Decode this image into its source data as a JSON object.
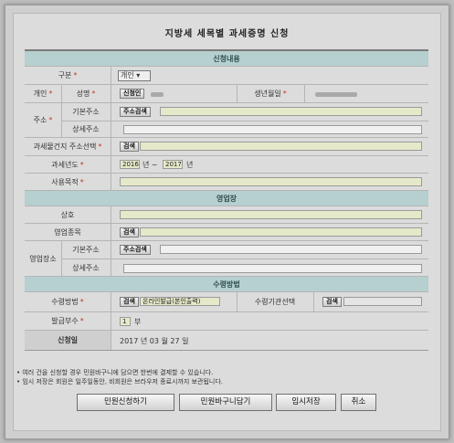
{
  "title": "지방세 세목별 과세증명 신청",
  "sections": {
    "apply": "신청내용",
    "business": "영업장",
    "receive": "수령방법"
  },
  "labels": {
    "category": "구분",
    "personal": "개인",
    "name": "성명",
    "birth": "생년월일",
    "address": "주소",
    "basic_address": "기본주소",
    "detail_address": "상세주소",
    "tax_object_address": "과세물건지 주소선택",
    "tax_year": "과세년도",
    "purpose": "사용목적",
    "trade_name": "상호",
    "business_type": "영업종목",
    "business_place": "영업장소",
    "receive_method": "수령방법",
    "receive_agency": "수령기관선택",
    "copies": "발급부수",
    "apply_date": "신청일"
  },
  "required_mark": "*",
  "values": {
    "category_selected": "개인",
    "tax_year_from": "2016",
    "tax_year_to": "2017",
    "year_unit": "년",
    "year_sep": "~",
    "receive_method_value": "온라인발급(본인출력)",
    "copies": "1",
    "copies_unit": "부",
    "apply_date": "2017  년 03  월 27  일"
  },
  "buttons": {
    "auth": "신청인",
    "address_search": "주소검색",
    "search": "검색",
    "submit": "민원신청하기",
    "basket": "민원바구니담기",
    "temp_save": "임시저장",
    "cancel": "취소"
  },
  "notes": [
    "• 여러 건을 신청할 경우 민원바구니에 담으면 한번에 결제할 수 있습니다.",
    "• 임시 저장은 회원은 일주일동안, 비회원은 브라우저 종료시까지 보관됩니다."
  ],
  "colors": {
    "section_bg": "#b6cfcf",
    "input_bg": "#e6e9c9",
    "required": "#c0392b"
  }
}
